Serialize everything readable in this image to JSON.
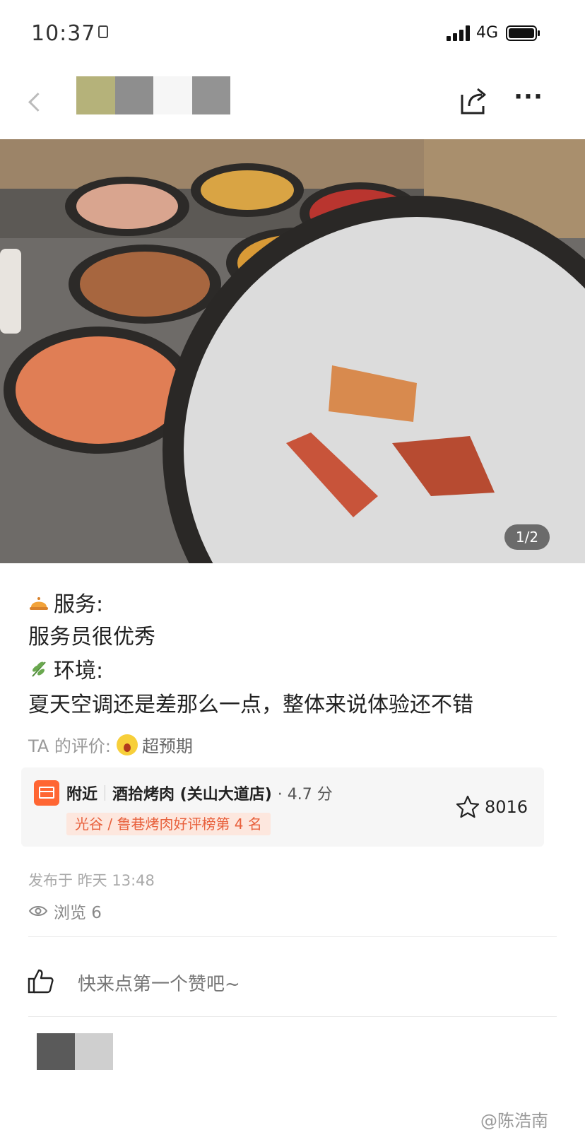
{
  "status_bar": {
    "time": "10:37",
    "network": "4G"
  },
  "header": {
    "back_icon": "chevron-left-icon",
    "share_icon": "share-icon",
    "more_label": "···"
  },
  "photo": {
    "page_indicator": "1/2"
  },
  "review": {
    "service_label": "服务:",
    "service_text": "服务员很优秀",
    "environment_label": "环境:",
    "environment_text": "夏天空调还是差那么一点，整体来说体验还不错",
    "rating_prefix": "TA 的评价:",
    "rating_value": "超预期"
  },
  "shop": {
    "nearby_label": "附近",
    "name": "酒拾烤肉 (关山大道店)",
    "score": "· 4.7 分",
    "badge": "光谷 / 鲁巷烤肉好评榜第 4 名",
    "fav_count": "8016"
  },
  "meta": {
    "published": "发布于  昨天 13:48",
    "views": "浏览 6"
  },
  "like": {
    "prompt": "快来点第一个赞吧~"
  },
  "watermark": "@陈浩南",
  "colors": {
    "accent": "#ff6633",
    "badge_bg": "#fde7de",
    "badge_text": "#e8603c"
  }
}
